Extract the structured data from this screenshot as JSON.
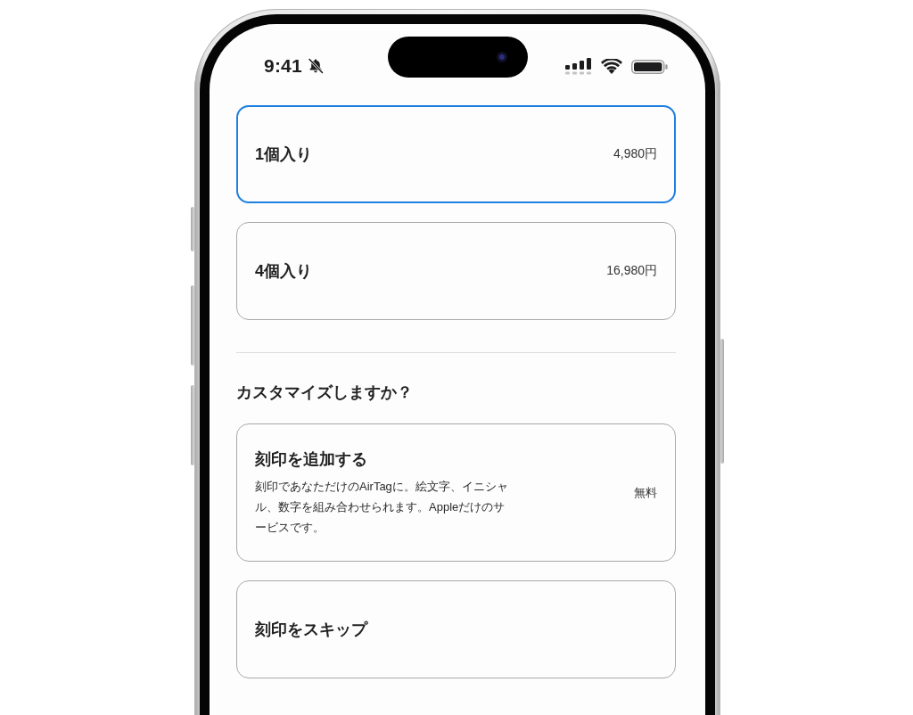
{
  "status_bar": {
    "time": "9:41"
  },
  "sizes": [
    {
      "label": "1個入り",
      "price": "4,980円",
      "selected": true
    },
    {
      "label": "4個入り",
      "price": "16,980円",
      "selected": false
    }
  ],
  "customize": {
    "heading": "カスタマイズしますか？",
    "options": [
      {
        "title": "刻印を追加する",
        "description": "刻印であなただけのAirTagに。絵文字、イニシャル、数字を組み合わせられます。Appleだけのサービスです。",
        "price": "無料",
        "selected": false
      },
      {
        "title": "刻印をスキップ",
        "selected": false
      }
    ]
  }
}
